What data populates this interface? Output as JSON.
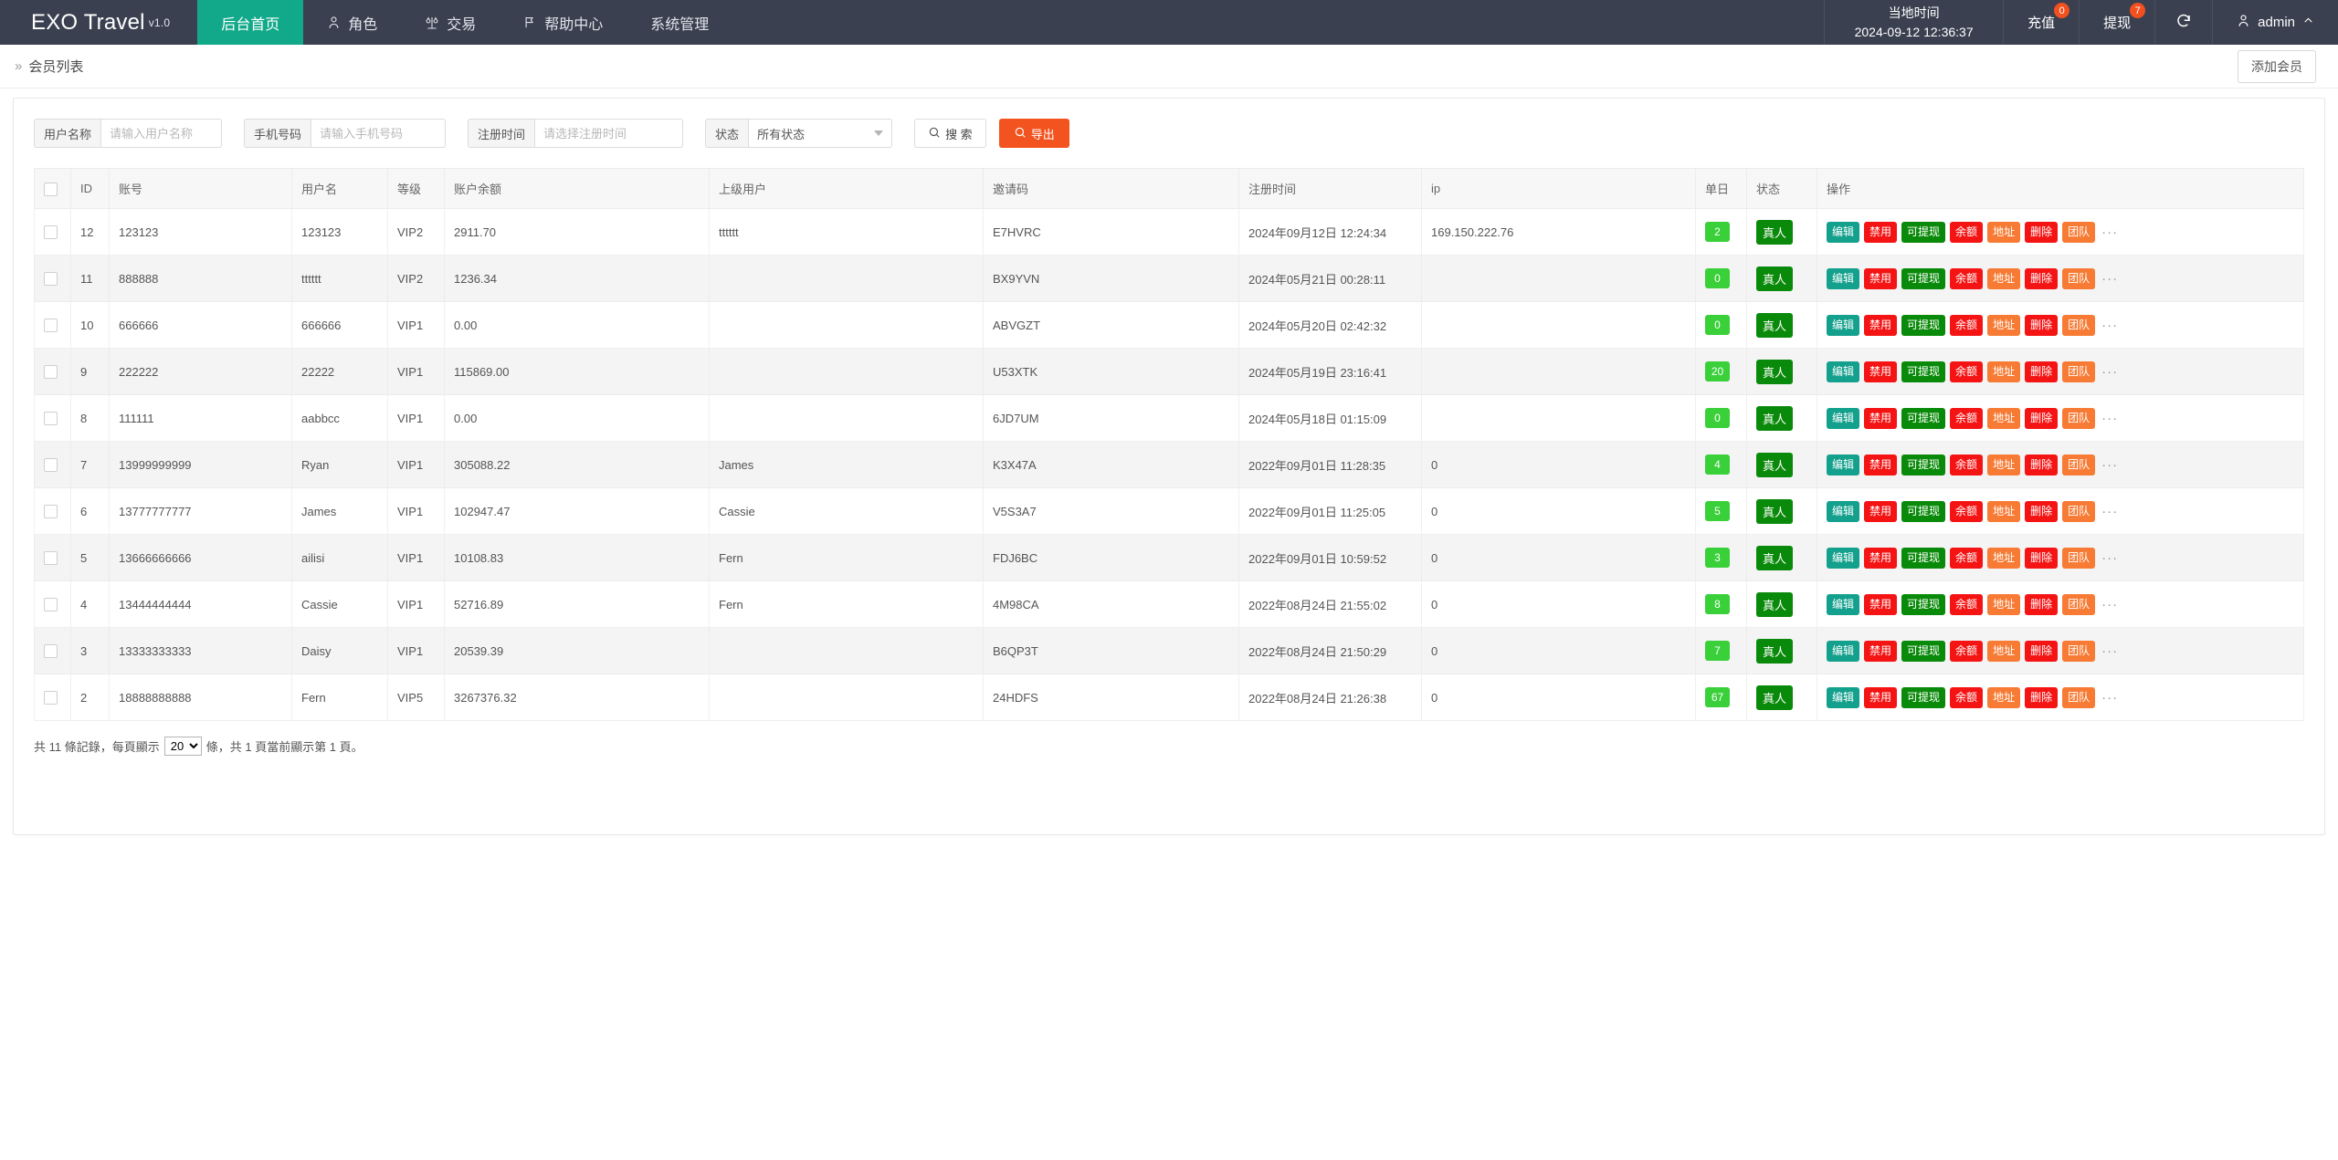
{
  "header": {
    "brand": "EXO Travel",
    "brand_version": "v1.0",
    "nav": [
      {
        "label": "后台首页",
        "icon": "",
        "active": true
      },
      {
        "label": "角色",
        "icon": "person-icon",
        "active": false
      },
      {
        "label": "交易",
        "icon": "scales-icon",
        "active": false
      },
      {
        "label": "帮助中心",
        "icon": "flag-icon",
        "active": false
      },
      {
        "label": "系统管理",
        "icon": "",
        "active": false
      }
    ],
    "local_time_label": "当地时间",
    "local_time_value": "2024-09-12 12:36:37",
    "recharge_label": "充值",
    "recharge_badge": "0",
    "withdraw_label": "提现",
    "withdraw_badge": "7",
    "refresh_icon": "refresh-icon",
    "user_name": "admin",
    "user_icon": "person-icon",
    "user_caret": "chevron-up-icon"
  },
  "breadcrumb": {
    "chevron": "»",
    "title": "会员列表",
    "add_member_label": "添加会员"
  },
  "filters": {
    "username_label": "用户名称",
    "username_placeholder": "请输入用户名称",
    "username_value": "",
    "phone_label": "手机号码",
    "phone_placeholder": "请输入手机号码",
    "phone_value": "",
    "regtime_label": "注册时间",
    "regtime_placeholder": "请选择注册时间",
    "regtime_value": "",
    "status_label": "状态",
    "status_value": "所有状态",
    "status_options": [
      "所有状态"
    ],
    "search_label": "搜 索",
    "search_icon": "search-icon",
    "export_label": "导出",
    "export_icon": "search-icon"
  },
  "table": {
    "columns": [
      {
        "key": "checkbox",
        "label": ""
      },
      {
        "key": "id",
        "label": "ID"
      },
      {
        "key": "account",
        "label": "账号"
      },
      {
        "key": "username",
        "label": "用户名"
      },
      {
        "key": "level",
        "label": "等级"
      },
      {
        "key": "balance",
        "label": "账户余额"
      },
      {
        "key": "parent",
        "label": "上级用户"
      },
      {
        "key": "invite",
        "label": "邀请码"
      },
      {
        "key": "regtime",
        "label": "注册时间"
      },
      {
        "key": "ip",
        "label": "ip"
      },
      {
        "key": "daily",
        "label": "单日"
      },
      {
        "key": "status",
        "label": "状态"
      },
      {
        "key": "ops",
        "label": "操作"
      }
    ],
    "op_buttons": [
      {
        "label": "编辑",
        "color": "#13a08c"
      },
      {
        "label": "禁用",
        "color": "#f51414"
      },
      {
        "label": "可提现",
        "color": "#0a8a0a"
      },
      {
        "label": "余额",
        "color": "#f51414"
      },
      {
        "label": "地址",
        "color": "#f77b34"
      },
      {
        "label": "删除",
        "color": "#f51414"
      },
      {
        "label": "团队",
        "color": "#f77b34"
      }
    ],
    "op_more": "···",
    "status_text": "真人",
    "rows": [
      {
        "id": "12",
        "account": "123123",
        "username": "123123",
        "level": "VIP2",
        "balance": "2911.70",
        "parent": "tttttt",
        "invite": "E7HVRC",
        "regtime": "2024年09月12日 12:24:34",
        "ip": "169.150.222.76",
        "daily": "2",
        "status": "真人"
      },
      {
        "id": "11",
        "account": "888888",
        "username": "tttttt",
        "level": "VIP2",
        "balance": "1236.34",
        "parent": "",
        "invite": "BX9YVN",
        "regtime": "2024年05月21日 00:28:11",
        "ip": "",
        "daily": "0",
        "status": "真人"
      },
      {
        "id": "10",
        "account": "666666",
        "username": "666666",
        "level": "VIP1",
        "balance": "0.00",
        "parent": "",
        "invite": "ABVGZT",
        "regtime": "2024年05月20日 02:42:32",
        "ip": "",
        "daily": "0",
        "status": "真人"
      },
      {
        "id": "9",
        "account": "222222",
        "username": "22222",
        "level": "VIP1",
        "balance": "115869.00",
        "parent": "",
        "invite": "U53XTK",
        "regtime": "2024年05月19日 23:16:41",
        "ip": "",
        "daily": "20",
        "status": "真人"
      },
      {
        "id": "8",
        "account": "111111",
        "username": "aabbcc",
        "level": "VIP1",
        "balance": "0.00",
        "parent": "",
        "invite": "6JD7UM",
        "regtime": "2024年05月18日 01:15:09",
        "ip": "",
        "daily": "0",
        "status": "真人"
      },
      {
        "id": "7",
        "account": "13999999999",
        "username": "Ryan",
        "level": "VIP1",
        "balance": "305088.22",
        "parent": "James",
        "invite": "K3X47A",
        "regtime": "2022年09月01日 11:28:35",
        "ip": "0",
        "daily": "4",
        "status": "真人"
      },
      {
        "id": "6",
        "account": "13777777777",
        "username": "James",
        "level": "VIP1",
        "balance": "102947.47",
        "parent": "Cassie",
        "invite": "V5S3A7",
        "regtime": "2022年09月01日 11:25:05",
        "ip": "0",
        "daily": "5",
        "status": "真人"
      },
      {
        "id": "5",
        "account": "13666666666",
        "username": "ailisi",
        "level": "VIP1",
        "balance": "10108.83",
        "parent": "Fern",
        "invite": "FDJ6BC",
        "regtime": "2022年09月01日 10:59:52",
        "ip": "0",
        "daily": "3",
        "status": "真人"
      },
      {
        "id": "4",
        "account": "13444444444",
        "username": "Cassie",
        "level": "VIP1",
        "balance": "52716.89",
        "parent": "Fern",
        "invite": "4M98CA",
        "regtime": "2022年08月24日 21:55:02",
        "ip": "0",
        "daily": "8",
        "status": "真人"
      },
      {
        "id": "3",
        "account": "13333333333",
        "username": "Daisy",
        "level": "VIP1",
        "balance": "20539.39",
        "parent": "",
        "invite": "B6QP3T",
        "regtime": "2022年08月24日 21:50:29",
        "ip": "0",
        "daily": "7",
        "status": "真人"
      },
      {
        "id": "2",
        "account": "18888888888",
        "username": "Fern",
        "level": "VIP5",
        "balance": "3267376.32",
        "parent": "",
        "invite": "24HDFS",
        "regtime": "2022年08月24日 21:26:38",
        "ip": "0",
        "daily": "67",
        "status": "真人"
      }
    ]
  },
  "footer": {
    "prefix": "共 11 條記錄，每頁顯示",
    "page_size": "20",
    "page_size_options": [
      "20"
    ],
    "suffix": "條，共 1 頁當前顯示第 1 頁。"
  }
}
